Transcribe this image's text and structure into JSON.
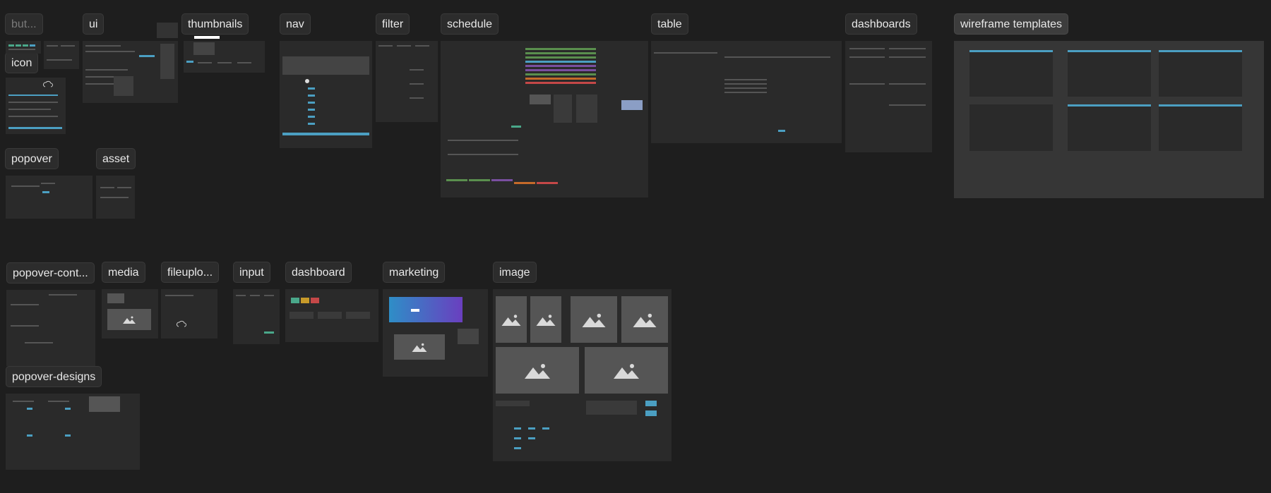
{
  "canvas": {
    "labels": {
      "buttons": "but...",
      "icon": "icon",
      "ui": "ui",
      "thumbnails": "thumbnails",
      "nav": "nav",
      "filter": "filter",
      "schedule": "schedule",
      "table": "table",
      "dashboards": "dashboards",
      "wireframe_templates": "wireframe templates",
      "popover": "popover",
      "asset": "asset",
      "popover_cont": "popover-cont...",
      "media": "media",
      "fileupload": "fileuplo...",
      "input": "input",
      "dashboard": "dashboard",
      "marketing": "marketing",
      "image": "image",
      "popover_designs": "popover-designs"
    }
  },
  "colors": {
    "canvas_bg": "#1e1e1e",
    "frame_bg": "#2a2a2a",
    "accent_teal": "#4b9fc2",
    "schedule_green": "#5a8f4e",
    "schedule_purple": "#7a4fa0",
    "schedule_orange": "#c56a2a",
    "schedule_red": "#c44848"
  }
}
